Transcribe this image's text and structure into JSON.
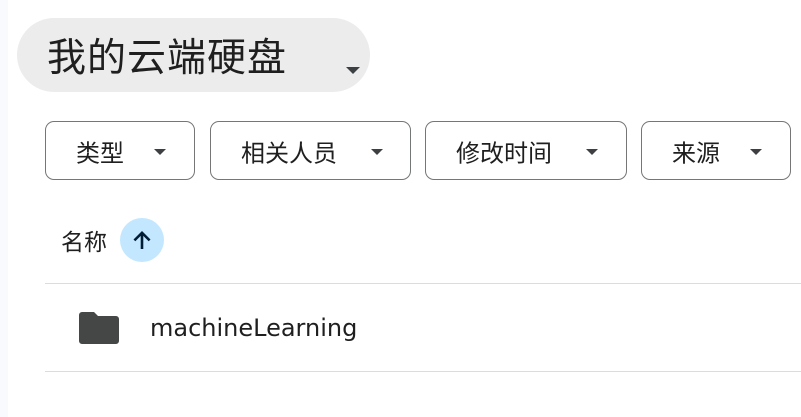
{
  "drive": {
    "title": "我的云端硬盘"
  },
  "filters": [
    {
      "label": "类型"
    },
    {
      "label": "相关人员"
    },
    {
      "label": "修改时间"
    },
    {
      "label": "来源"
    }
  ],
  "list_header": {
    "name_label": "名称",
    "sort_direction": "ascending",
    "sort_icon": "arrow-up-icon"
  },
  "files": [
    {
      "name": "machineLearning",
      "type": "folder",
      "icon": "folder-icon"
    }
  ],
  "colors": {
    "title_chip_bg": "#ececec",
    "sort_button_bg": "#c2e7ff",
    "sort_arrow": "#001d35",
    "folder": "#444746",
    "filter_border": "#747775"
  }
}
